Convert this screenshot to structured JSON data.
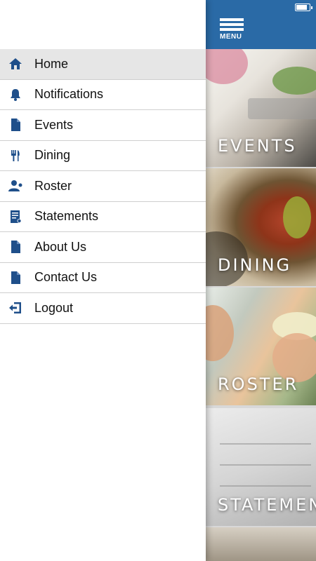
{
  "menu": {
    "label": "MENU"
  },
  "nav": {
    "items": [
      {
        "label": "Home",
        "icon": "home-icon"
      },
      {
        "label": "Notifications",
        "icon": "bell-icon"
      },
      {
        "label": "Events",
        "icon": "document-icon"
      },
      {
        "label": "Dining",
        "icon": "fork-knife-icon"
      },
      {
        "label": "Roster",
        "icon": "person-icon"
      },
      {
        "label": "Statements",
        "icon": "statement-icon"
      },
      {
        "label": "About Us",
        "icon": "document-icon"
      },
      {
        "label": "Contact Us",
        "icon": "document-icon"
      },
      {
        "label": "Logout",
        "icon": "logout-icon"
      }
    ]
  },
  "tiles": [
    {
      "label": "EVENTS"
    },
    {
      "label": "DINING"
    },
    {
      "label": "ROSTER"
    },
    {
      "label": "STATEMEN"
    }
  ],
  "colors": {
    "brand": "#2a6aa6",
    "icon": "#1f4f8a",
    "active_row": "#e6e6e6"
  }
}
